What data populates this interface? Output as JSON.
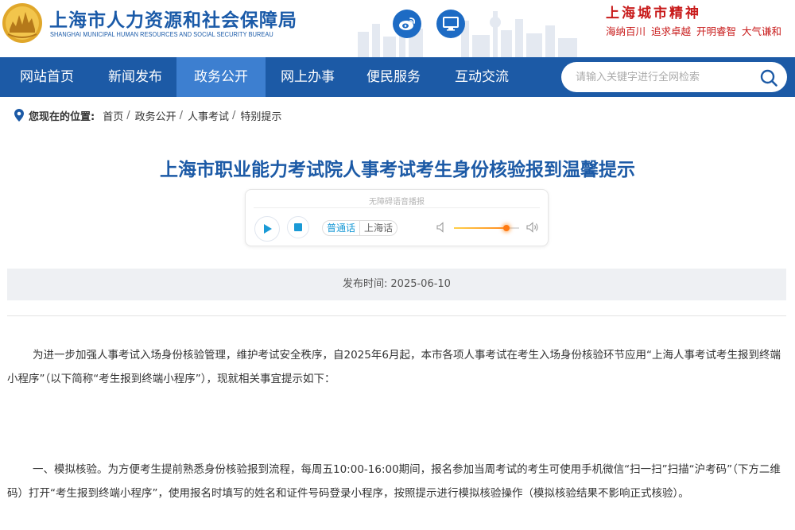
{
  "header": {
    "title_cn": "上海市人力资源和社会保障局",
    "title_en": "SHANGHAI MUNICIPAL HUMAN RESOURCES AND SOCIAL SECURITY BUREAU",
    "weibo_icon": "weibo-icon",
    "pc_icon": "desktop-icon",
    "spirit_title": "上海城市精神",
    "spirit_values": [
      "海纳百川",
      "追求卓越",
      "开明睿智",
      "大气谦和"
    ]
  },
  "nav": {
    "items": [
      {
        "label": "网站首页",
        "active": false
      },
      {
        "label": "新闻发布",
        "active": false
      },
      {
        "label": "政务公开",
        "active": true
      },
      {
        "label": "网上办事",
        "active": false
      },
      {
        "label": "便民服务",
        "active": false
      },
      {
        "label": "互动交流",
        "active": false
      }
    ],
    "search_placeholder": "请输入关键字进行全网检索"
  },
  "breadcrumb": {
    "label": "您现在的位置:",
    "items": [
      "首页",
      "政务公开",
      "人事考试",
      "特别提示"
    ],
    "separator": "/"
  },
  "article": {
    "title": "上海市职业能力考试院人事考试考生身份核验报到温馨提示",
    "publish_label": "发布时间:",
    "publish_date": "2025-06-10",
    "paragraphs": [
      "为进一步加强人事考试入场身份核验管理，维护考试安全秩序，自2025年6月起，本市各项人事考试在考生入场身份核验环节应用“上海人事考试考生报到终端小程序”（以下简称“考生报到终端小程序”），现就相关事宜提示如下：",
      "一、模拟核验。为方便考生提前熟悉身份核验报到流程，每周五10:00-16:00期间，报名参加当周考试的考生可使用手机微信“扫一扫”扫描“沪考码”（下方二维码）打开“考生报到终端小程序”，使用报名时填写的姓名和证件号码登录小程序，按照提示进行模拟核验操作（模拟核验结果不影响正式核验）。"
    ]
  },
  "player": {
    "caption": "无障碍语音播报",
    "lang_active": "普通话",
    "lang_other": "上海话",
    "volume_fraction": 0.8,
    "accent_color": "#1a9ad6",
    "volume_color": "#ff7a12"
  },
  "colors": {
    "brand_blue": "#1c5aa6",
    "nav_active": "#3d7fd0",
    "spirit_red": "#c81a1a"
  }
}
